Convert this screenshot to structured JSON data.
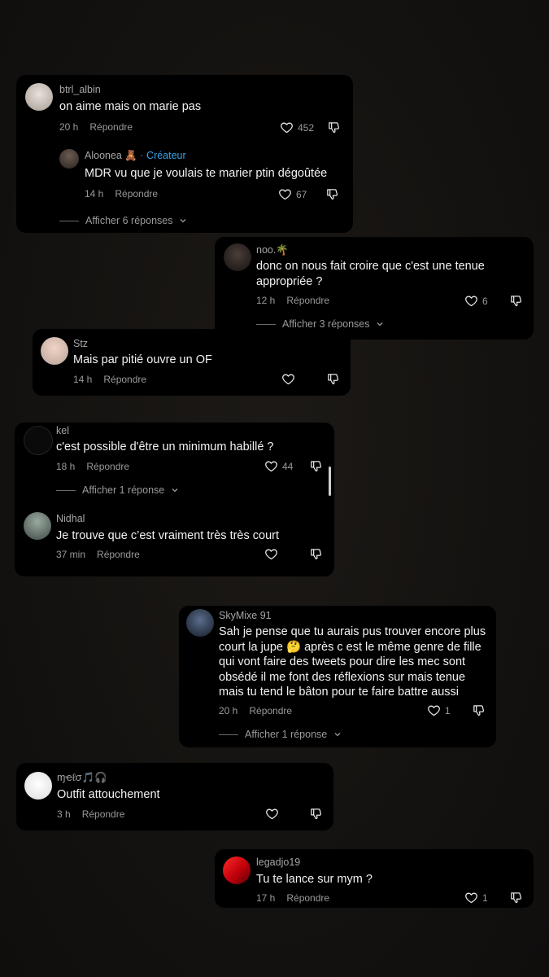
{
  "comments": [
    {
      "username": "btrl_albin",
      "text": "on aime mais on marie pas",
      "time": "20 h",
      "reply": "Répondre",
      "likes": "452"
    },
    {
      "username": "Aloonea 🧸",
      "creator_label": "· Créateur",
      "text": "MDR vu que je voulais te marier ptin dégoûtée",
      "time": "14 h",
      "reply": "Répondre",
      "likes": "67",
      "more": "Afficher 6 réponses"
    },
    {
      "username": "noo.🌴",
      "text": "donc on nous fait croire que c'est une tenue appropriée ?",
      "time": "12 h",
      "reply": "Répondre",
      "likes": "6",
      "more": "Afficher 3 réponses"
    },
    {
      "username": "Stz",
      "text": "Mais par pitié ouvre un OF",
      "time": "14 h",
      "reply": "Répondre",
      "likes": ""
    },
    {
      "username": "kel",
      "text": "c'est possible d'être un minimum habillé ?",
      "time": "18 h",
      "reply": "Répondre",
      "likes": "44",
      "more": "Afficher 1 réponse"
    },
    {
      "username": "Nidhal",
      "text": "Je trouve que c’est vraiment très très court",
      "time": "37 min",
      "reply": "Répondre",
      "likes": ""
    },
    {
      "username": "SkyMixe 91",
      "text": "Sah je pense que tu aurais pus trouver encore plus court la jupe 🤔 après c est le même genre de fille qui vont faire des tweets pour dire les mec sont obsédé il me font des réflexions sur mais tenue mais tu tend le bâton pour te faire battre aussi",
      "time": "20 h",
      "reply": "Répondre",
      "likes": "1",
      "more": "Afficher 1 réponse"
    },
    {
      "username": "ɱҽℓσ🎵🎧",
      "text": "Outfit attouchement",
      "time": "3 h",
      "reply": "Répondre",
      "likes": ""
    },
    {
      "username": "legadjo19",
      "text": "Tu te lance sur mym ?",
      "time": "17 h",
      "reply": "Répondre",
      "likes": "1"
    }
  ],
  "icons": {
    "like": "heart-outline-icon",
    "dislike": "thumbs-down-icon",
    "chevron": "chevron-down-icon"
  },
  "colors": {
    "card": "#000000",
    "creator": "#35a4ea",
    "muted": "#9a9a9a"
  }
}
